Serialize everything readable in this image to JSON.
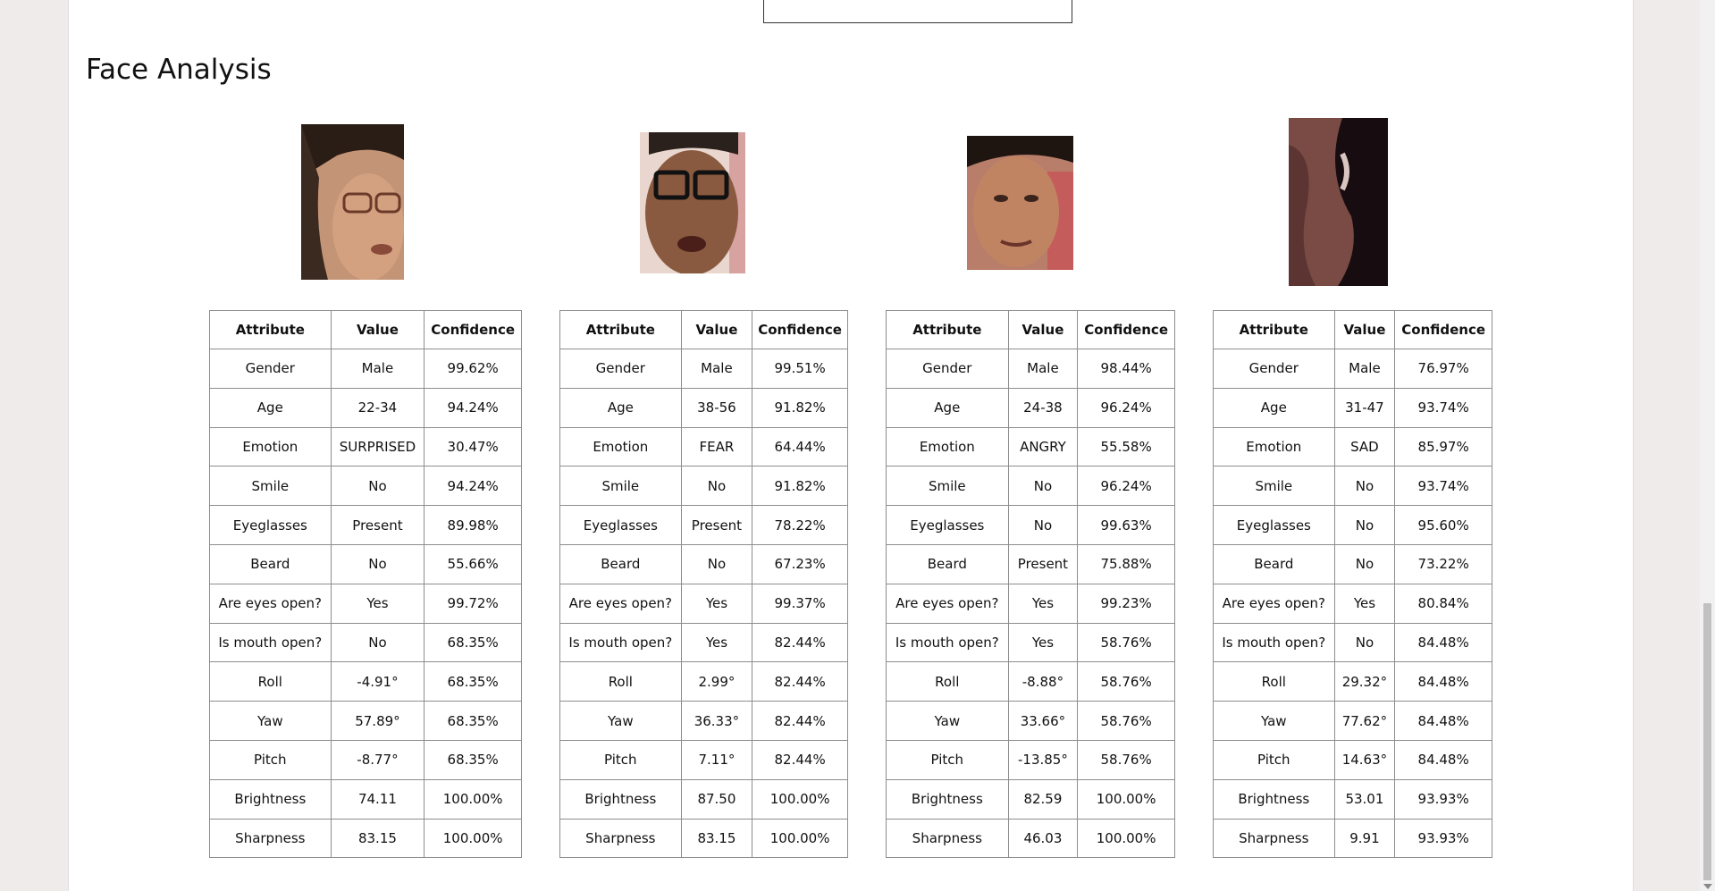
{
  "section_title": "Face Analysis",
  "headers": {
    "attribute": "Attribute",
    "value": "Value",
    "confidence": "Confidence"
  },
  "attributes": [
    "Gender",
    "Age",
    "Emotion",
    "Smile",
    "Eyeglasses",
    "Beard",
    "Are eyes open?",
    "Is mouth open?",
    "Roll",
    "Yaw",
    "Pitch",
    "Brightness",
    "Sharpness"
  ],
  "faces": [
    {
      "values": [
        "Male",
        "22-34",
        "SURPRISED",
        "No",
        "Present",
        "No",
        "Yes",
        "No",
        "-4.91°",
        "57.89°",
        "-8.77°",
        "74.11",
        "83.15"
      ],
      "confidences": [
        "99.62%",
        "94.24%",
        "30.47%",
        "94.24%",
        "89.98%",
        "55.66%",
        "99.72%",
        "68.35%",
        "68.35%",
        "68.35%",
        "68.35%",
        "100.00%",
        "100.00%"
      ]
    },
    {
      "values": [
        "Male",
        "38-56",
        "FEAR",
        "No",
        "Present",
        "No",
        "Yes",
        "Yes",
        "2.99°",
        "36.33°",
        "7.11°",
        "87.50",
        "83.15"
      ],
      "confidences": [
        "99.51%",
        "91.82%",
        "64.44%",
        "91.82%",
        "78.22%",
        "67.23%",
        "99.37%",
        "82.44%",
        "82.44%",
        "82.44%",
        "82.44%",
        "100.00%",
        "100.00%"
      ]
    },
    {
      "values": [
        "Male",
        "24-38",
        "ANGRY",
        "No",
        "No",
        "Present",
        "Yes",
        "Yes",
        "-8.88°",
        "33.66°",
        "-13.85°",
        "82.59",
        "46.03"
      ],
      "confidences": [
        "98.44%",
        "96.24%",
        "55.58%",
        "96.24%",
        "99.63%",
        "75.88%",
        "99.23%",
        "58.76%",
        "58.76%",
        "58.76%",
        "58.76%",
        "100.00%",
        "100.00%"
      ]
    },
    {
      "values": [
        "Male",
        "31-47",
        "SAD",
        "No",
        "No",
        "No",
        "Yes",
        "No",
        "29.32°",
        "77.62°",
        "14.63°",
        "53.01",
        "9.91"
      ],
      "confidences": [
        "76.97%",
        "93.74%",
        "85.97%",
        "93.74%",
        "95.60%",
        "73.22%",
        "80.84%",
        "84.48%",
        "84.48%",
        "84.48%",
        "84.48%",
        "93.93%",
        "93.93%"
      ]
    }
  ]
}
